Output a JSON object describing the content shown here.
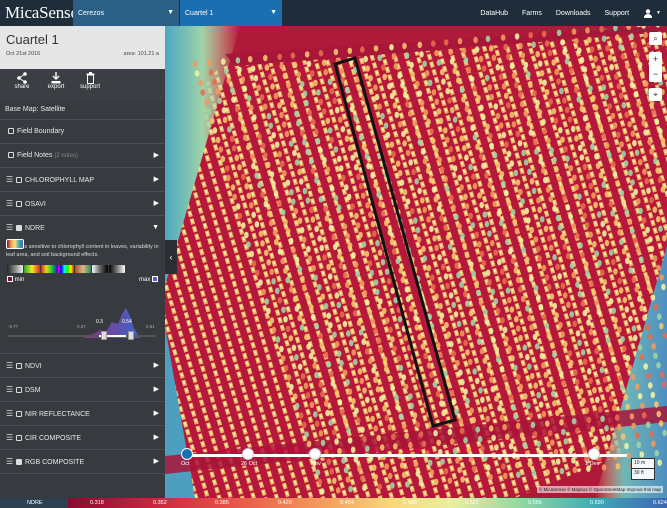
{
  "app": {
    "logo": "MicaSense"
  },
  "topbar": {
    "farm_select": "Cerezos",
    "field_select": "Cuartel 1",
    "nav": [
      "DataHub",
      "Farms",
      "Downloads",
      "Support"
    ],
    "user_icon": "user-icon"
  },
  "field": {
    "title": "Cuartel 1",
    "date": "Oct 21st 2016",
    "area": "area: 101.21 a"
  },
  "actions": [
    {
      "label": "share",
      "icon": "share-icon"
    },
    {
      "label": "export",
      "icon": "download-icon"
    },
    {
      "label": "support",
      "icon": "trash-icon"
    }
  ],
  "basemap": "Base Map: Satellite",
  "layers": {
    "field_boundary": "Field Boundary",
    "field_notes": "Field Notes",
    "field_notes_sub": "(2 notes)",
    "chlorophyll": "CHLOROPHYLL MAP",
    "osavi": "OSAVI",
    "ndre": "NDRE",
    "ndre_desc": "NDRE is sensitive to chlorophyll content in leaves, variability in leaf area, and soil background effects.",
    "ndvi": "NDVI",
    "dsm": "DSM",
    "nir": "NIR REFLECTANCE",
    "cir": "CIR COMPOSITE",
    "rgb": "RGB COMPOSITE"
  },
  "ndre_range": {
    "min_label": "min",
    "max_label": "max",
    "range_min": "-0.77",
    "range_max": "0.81",
    "low": "0.3",
    "high": "0.54",
    "mid_tick": "0.07",
    "low_tick": "0.5",
    "min_color": "#8b0a30",
    "max_color": "#5a5ad0",
    "low_fraction": 0.65,
    "high_fraction": 0.83
  },
  "timeline": {
    "labels": [
      "Oct",
      "26 Oct",
      "Nov",
      "1 Dec"
    ]
  },
  "map": {
    "scale_m": "10 m",
    "scale_ft": "30 ft",
    "attribution": "© MicaSense © Mapbox © OpenStreetMap  Improve this map",
    "controls": [
      "search-icon",
      "zoom-in",
      "zoom-out",
      "location-icon"
    ]
  },
  "legend": {
    "label": "NDRE",
    "ticks": [
      "0.318",
      "0.352",
      "0.385",
      "0.420",
      "0.454",
      "0.488",
      "0.522",
      "0.556",
      "0.590",
      "0.624"
    ]
  }
}
